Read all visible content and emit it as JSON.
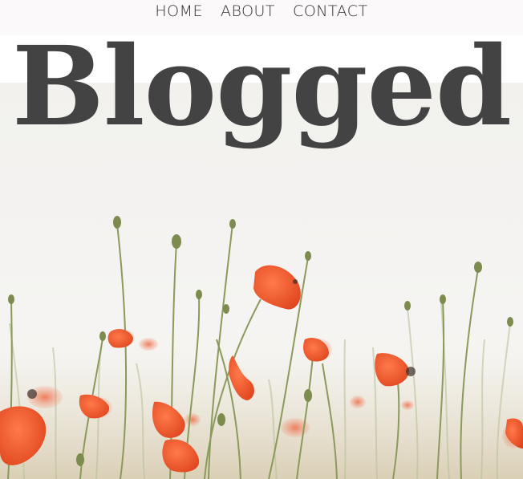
{
  "nav": {
    "items": [
      {
        "label": "HOME"
      },
      {
        "label": "ABOUT"
      },
      {
        "label": "CONTACT"
      }
    ]
  },
  "site": {
    "title": "Blogged"
  },
  "colors": {
    "nav_background": "#fbf9f9",
    "title_text": "#434343",
    "hero_sky": "#f2f1ee",
    "poppy": "#e8532a",
    "stem": "#8a9a5b"
  }
}
